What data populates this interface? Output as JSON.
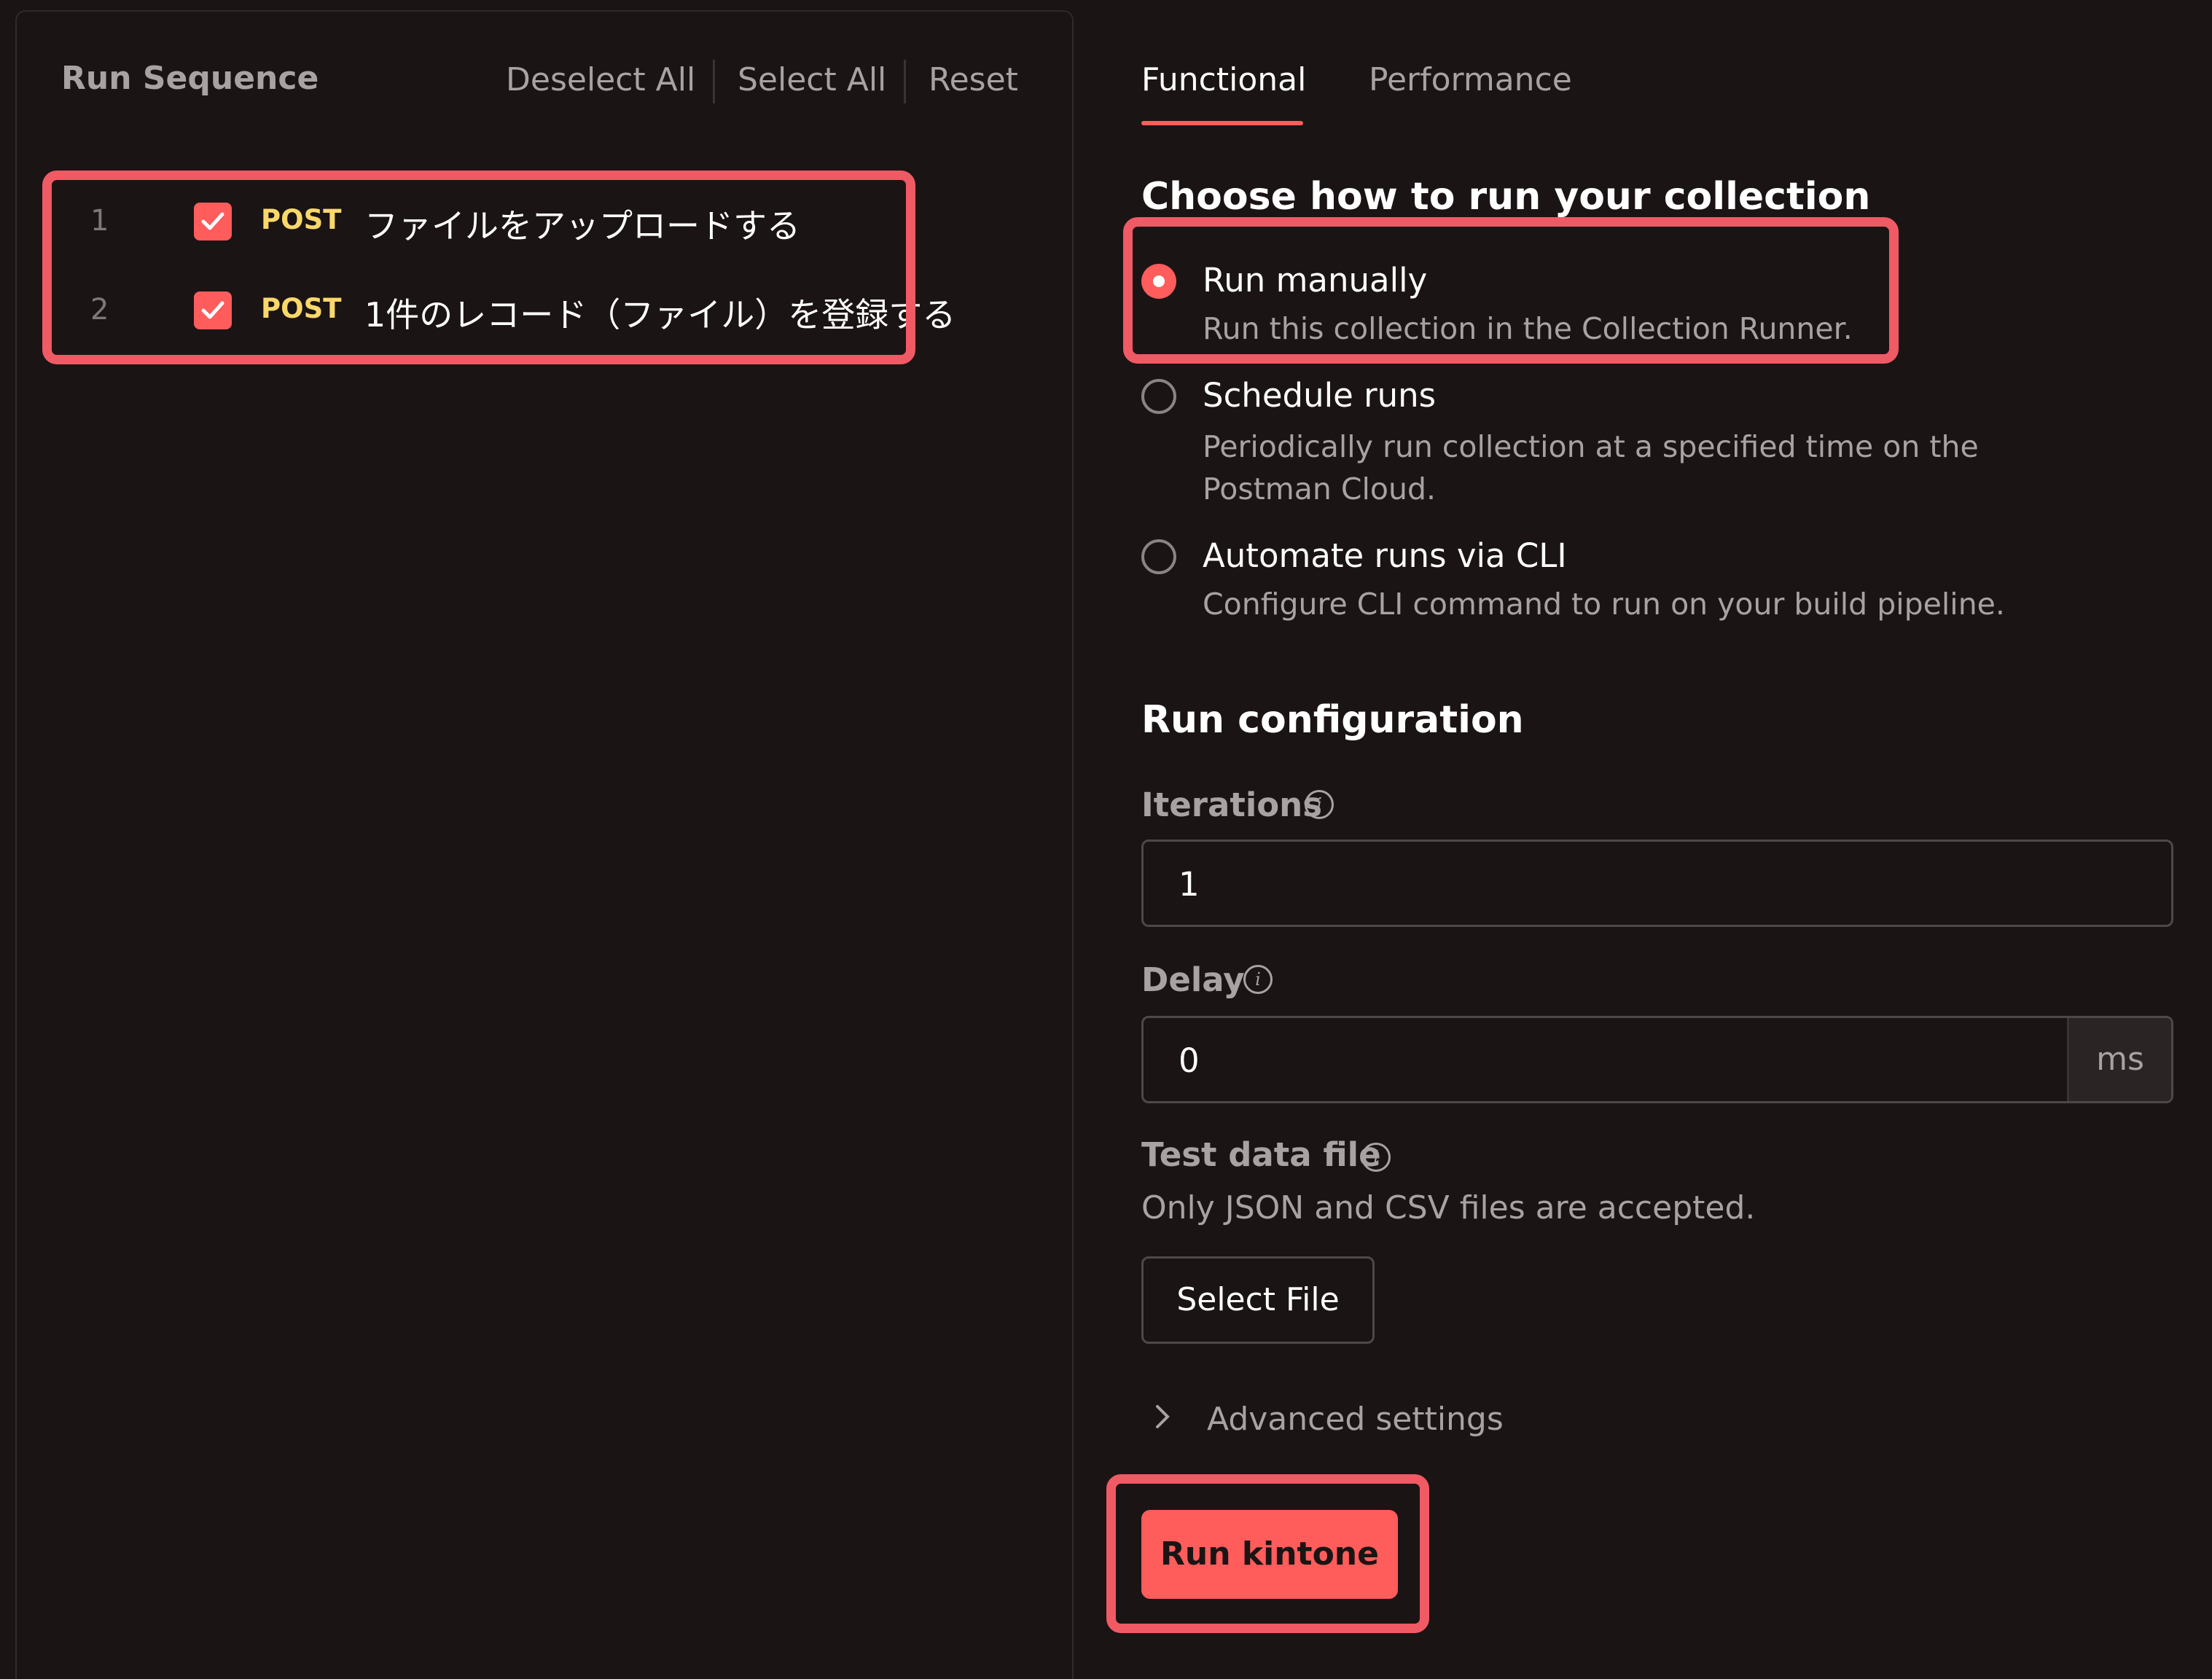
{
  "run_sequence": {
    "title": "Run Sequence",
    "actions": {
      "deselect_all": "Deselect All",
      "select_all": "Select All",
      "reset": "Reset"
    },
    "requests": [
      {
        "number": "1",
        "checked": true,
        "method": "POST",
        "name": "ファイルをアップロードする"
      },
      {
        "number": "2",
        "checked": true,
        "method": "POST",
        "name": "1件のレコード（ファイル）を登録する"
      }
    ]
  },
  "tabs": [
    {
      "label": "Functional",
      "active": true
    },
    {
      "label": "Performance",
      "active": false
    }
  ],
  "run_mode": {
    "heading": "Choose how to run your collection",
    "options": [
      {
        "title": "Run manually",
        "description": "Run this collection in the Collection Runner.",
        "selected": true
      },
      {
        "title": "Schedule runs",
        "description": "Periodically run collection at a specified time on the Postman Cloud.",
        "selected": false
      },
      {
        "title": "Automate runs via CLI",
        "description": "Configure CLI command to run on your build pipeline.",
        "selected": false
      }
    ]
  },
  "run_configuration": {
    "heading": "Run configuration",
    "iterations": {
      "label": "Iterations",
      "value": "1"
    },
    "delay": {
      "label": "Delay",
      "value": "0",
      "unit": "ms"
    },
    "test_data_file": {
      "label": "Test data file",
      "help": "Only JSON and CSV files are accepted.",
      "button": "Select File"
    },
    "advanced_settings": "Advanced settings",
    "run_button": "Run kintone"
  },
  "colors": {
    "background": "#1b1414",
    "accent": "#ff5c5c",
    "method_post": "#f9d86b",
    "highlight": "#f05a64"
  }
}
